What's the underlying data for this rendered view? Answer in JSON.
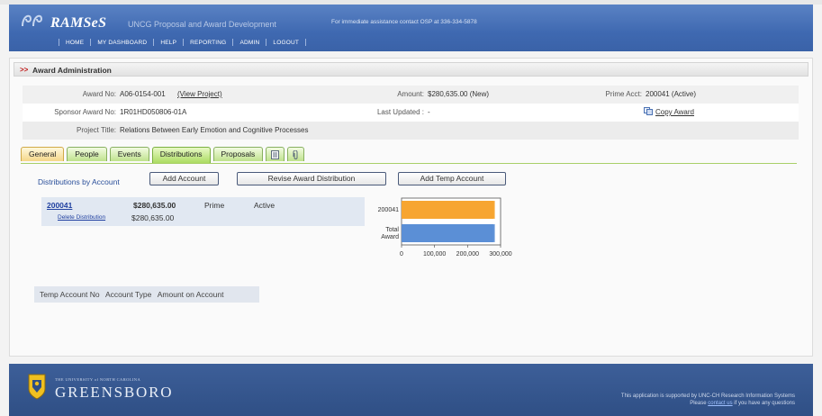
{
  "header": {
    "app_name": "RAMSeS",
    "app_subtitle": "UNCG Proposal and Award Development",
    "assistance": "For immediate assistance contact OSP at 336-334-5878",
    "nav": [
      "HOME",
      "MY DASHBOARD",
      "HELP",
      "REPORTING",
      "ADMIN",
      "LOGOUT"
    ]
  },
  "section": {
    "arrows": ">>",
    "title": "Award Administration"
  },
  "award": {
    "award_no_label": "Award No:",
    "award_no": "A06-0154-001",
    "view_project": "(View Project)",
    "amount_label": "Amount:",
    "amount": "$280,635.00 (New)",
    "prime_acct_label": "Prime Acct:",
    "prime_acct": "200041 (Active)",
    "sponsor_label": "Sponsor Award No:",
    "sponsor_no": "1R01HD050806-01A",
    "last_updated_label": "Last Updated :",
    "last_updated": "-",
    "copy_award": "Copy Award",
    "title_label": "Project Title:",
    "title": "Relations Between Early Emotion and Cognitive Processes"
  },
  "tabs": [
    "General",
    "People",
    "Events",
    "Distributions",
    "Proposals"
  ],
  "distributions": {
    "title": "Distributions by Account",
    "add_account": "Add Account",
    "revise": "Revise Award Distribution",
    "add_temp": "Add Temp Account",
    "account": {
      "number": "200041",
      "amount": "$280,635.00",
      "type": "Prime",
      "status": "Active",
      "delete": "Delete Distribution",
      "dist_amount": "$280,635.00"
    }
  },
  "temp_accounts": {
    "headers": [
      "Temp Account No",
      "Account Type",
      "Amount on Account"
    ]
  },
  "chart_data": {
    "type": "bar",
    "orientation": "horizontal",
    "categories": [
      "200041",
      "Total Award"
    ],
    "values": [
      280635,
      280635
    ],
    "colors": [
      "#f7a531",
      "#5b8fd6"
    ],
    "xlim": [
      0,
      300000
    ],
    "ticks": [
      "0",
      "100,000",
      "200,000",
      "300,000"
    ]
  },
  "footer": {
    "uni_small": "THE UNIVERSITY of NORTH CAROLINA",
    "uni_big": "GREENSBORO",
    "support": "This application is supported by UNC-CH Research Information Systems",
    "please": "Please",
    "contact": "contact us",
    "questions": "if you have any questions"
  },
  "colors": {
    "header_blue": "#3f69b1",
    "footer_blue": "#2f4f85",
    "link_blue": "#2040a0",
    "tab_green": "#a8da5c",
    "tab_general": "#f5d789"
  }
}
